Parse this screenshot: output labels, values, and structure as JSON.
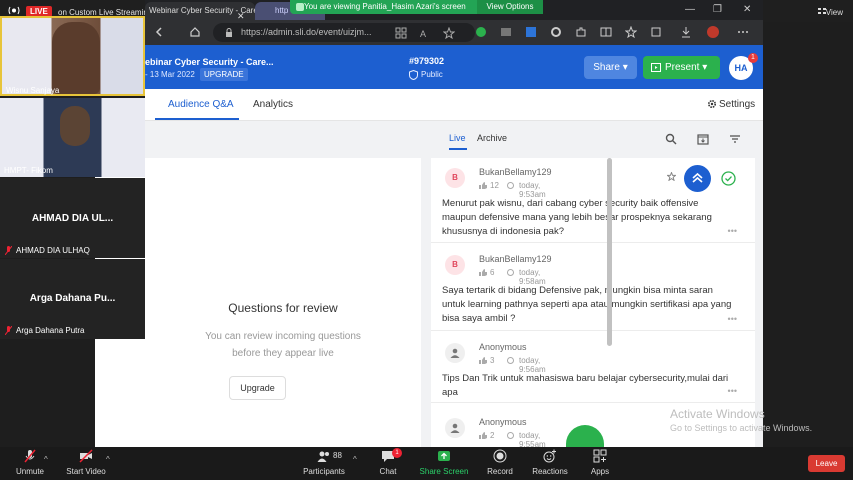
{
  "zoom": {
    "live_badge": "LIVE",
    "live_status": "on Custom Live Streaming Service",
    "share_banner": "You are viewing Panitia_Hasim Azari's screen",
    "view_options": "View Options",
    "view_label": "View"
  },
  "browser": {
    "tab_title": "Webinar Cyber Security - Career",
    "tab2_title": "http",
    "url": "https://admin.sli.do/event/uizjm..."
  },
  "slido": {
    "event_title": "ebinar Cyber Security - Care...",
    "event_date": "- 13 Mar 2022",
    "upgrade_pill": "UPGRADE",
    "event_code": "#979302",
    "visibility": "Public",
    "share_btn": "Share",
    "present_btn": "Present",
    "avatar_initials": "HA",
    "avatar_badge": "1",
    "tabs": [
      "Audience Q&A",
      "Analytics"
    ],
    "settings": "Settings",
    "review": {
      "title": "Questions for review",
      "subtitle_line1": "You can review incoming questions",
      "subtitle_line2": "before they appear live",
      "upgrade_btn": "Upgrade"
    },
    "list_tabs": {
      "live": "Live",
      "archive": "Archive"
    },
    "questions": [
      {
        "initial": "B",
        "author": "BukanBellamy129",
        "likes": "12",
        "time": "today, 9:53am",
        "text": "Menurut pak wisnu, dari cabang cyber security baik offensive maupun defensive mana yang lebih besar prospeknya sekarang khususnya di indonesia pak?"
      },
      {
        "initial": "B",
        "author": "BukanBellamy129",
        "likes": "6",
        "time": "today, 9:58am",
        "text": "Saya tertarik di bidang Defensive pak, mungkin bisa minta saran untuk learning pathnya seperti apa atau mungkin sertifikasi apa yang bisa saya ambil ?"
      },
      {
        "initial": "",
        "author": "Anonymous",
        "likes": "3",
        "time": "today, 9:56am",
        "text": "Tips Dan Trik untuk mahasiswa baru belajar cybersecurity,mulai dari apa"
      },
      {
        "initial": "",
        "author": "Anonymous",
        "likes": "2",
        "time": "today, 9:55am",
        "text": ""
      }
    ]
  },
  "participants": [
    {
      "name": "Wisnu Sanjaya"
    },
    {
      "name": "HMPT- Fikom"
    },
    {
      "name": "AHMAD DIA UL...",
      "full": "AHMAD DIA ULHAQ"
    },
    {
      "name": "Arga Dahana Pu...",
      "full": "Arga Dahana Putra"
    }
  ],
  "windows_watermark": {
    "title": "Activate Windows",
    "subtitle": "Go to Settings to activate Windows."
  },
  "toolbar": {
    "unmute": "Unmute",
    "start_video": "Start Video",
    "participants": "Participants",
    "participants_count": "88",
    "chat": "Chat",
    "chat_badge": "1",
    "share_screen": "Share Screen",
    "record": "Record",
    "reactions": "Reactions",
    "apps": "Apps",
    "leave": "Leave"
  }
}
